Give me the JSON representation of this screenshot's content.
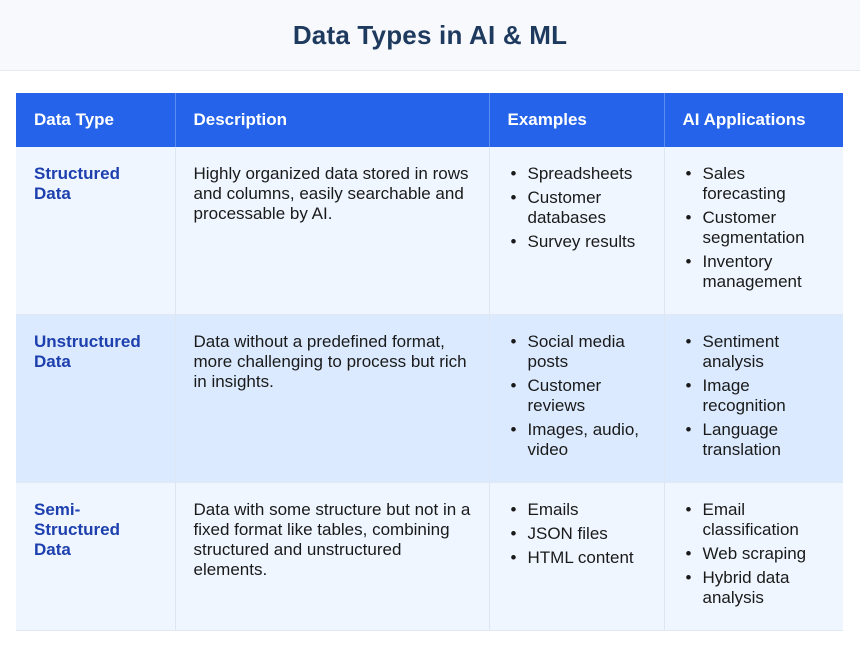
{
  "title": "Data Types in AI & ML",
  "table": {
    "headers": [
      "Data Type",
      "Description",
      "Examples",
      "AI Applications"
    ],
    "rows": [
      {
        "type": "Structured Data",
        "description": "Highly organized data stored in rows and columns, easily searchable and processable by AI.",
        "examples": [
          "Spreadsheets",
          "Customer databases",
          "Survey results"
        ],
        "applications": [
          "Sales forecasting",
          "Customer segmentation",
          "Inventory management"
        ]
      },
      {
        "type": "Unstructured Data",
        "description": "Data without a predefined format, more challenging to process but rich in insights.",
        "examples": [
          "Social media posts",
          "Customer reviews",
          "Images, audio, video"
        ],
        "applications": [
          "Sentiment analysis",
          "Image recognition",
          "Language translation"
        ]
      },
      {
        "type": "Semi-Structured Data",
        "description": "Data with some structure but not in a fixed format like tables, combining structured and unstructured elements.",
        "examples": [
          "Emails",
          "JSON files",
          "HTML content"
        ],
        "applications": [
          "Email classification",
          "Web scraping",
          "Hybrid data analysis"
        ]
      }
    ]
  },
  "colors": {
    "header_bg": "#2563eb",
    "title": "#1f3a5f",
    "type_label": "#1e40af",
    "row_light": "#eff6ff",
    "row_highlight": "#dbeafe"
  }
}
